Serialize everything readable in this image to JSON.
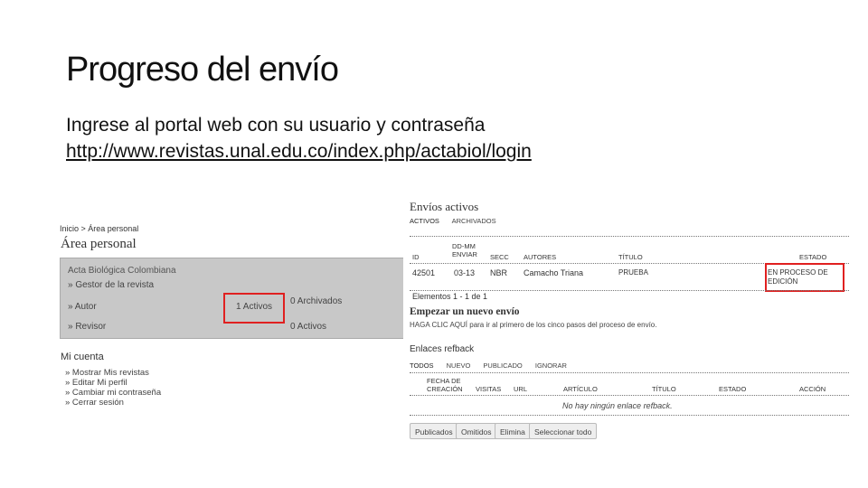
{
  "slide": {
    "title": "Progreso del envío",
    "instruction": "Ingrese al portal web con su usuario y contraseña",
    "url": "http://www.revistas.unal.edu.co/index.php/actabiol/login"
  },
  "left_panel": {
    "breadcrumb": "Inicio > Área personal",
    "title": "Área personal",
    "journal": "Acta Biológica Colombiana",
    "roles": [
      {
        "label": "» Gestor de la revista",
        "col1": "",
        "col2": ""
      },
      {
        "label": "» Autor",
        "col1": "1 Activos",
        "col2": "0 Archivados"
      },
      {
        "label": "» Revisor",
        "col1": "",
        "col2": "0 Activos"
      }
    ],
    "mi_cuenta": {
      "title": "Mi cuenta",
      "items": [
        "» Mostrar Mis revistas",
        "» Editar Mi perfil",
        "» Cambiar mi contraseña",
        "» Cerrar sesión"
      ]
    },
    "highlight_color": "#e02020"
  },
  "right_panel": {
    "title": "Envíos activos",
    "tabs": [
      "ACTIVOS",
      "ARCHIVADOS"
    ],
    "table": {
      "headers": {
        "id": "ID",
        "date": "DD-MM ENVIAR",
        "section": "SECC",
        "authors": "AUTORES",
        "title": "TÍTULO",
        "status": "ESTADO"
      },
      "rows": [
        {
          "id": "42501",
          "date": "03-13",
          "section": "NBR",
          "authors": "Camacho Triana",
          "title": "PRUEBA",
          "status": "EN PROCESO DE EDICIÓN"
        }
      ],
      "footer": "Elementos 1 - 1 de 1"
    },
    "new_submission": {
      "title": "Empezar un nuevo envío",
      "note": "HAGA CLIC AQUÍ para ir al primero de los cinco pasos del proceso de envío."
    },
    "refback": {
      "title": "Enlaces refback",
      "tabs": [
        "TODOS",
        "NUEVO",
        "PUBLICADO",
        "IGNORAR"
      ],
      "headers": {
        "created": "FECHA DE CREACIÓN",
        "visits": "VISITAS",
        "url": "URL",
        "article": "ARTÍCULO",
        "title": "TÍTULO",
        "status": "ESTADO",
        "action": "ACCIÓN"
      },
      "empty": "No hay ningún enlace refback."
    },
    "buttons": [
      "Publicados",
      "Omitidos",
      "Elimina",
      "Seleccionar todo"
    ]
  }
}
